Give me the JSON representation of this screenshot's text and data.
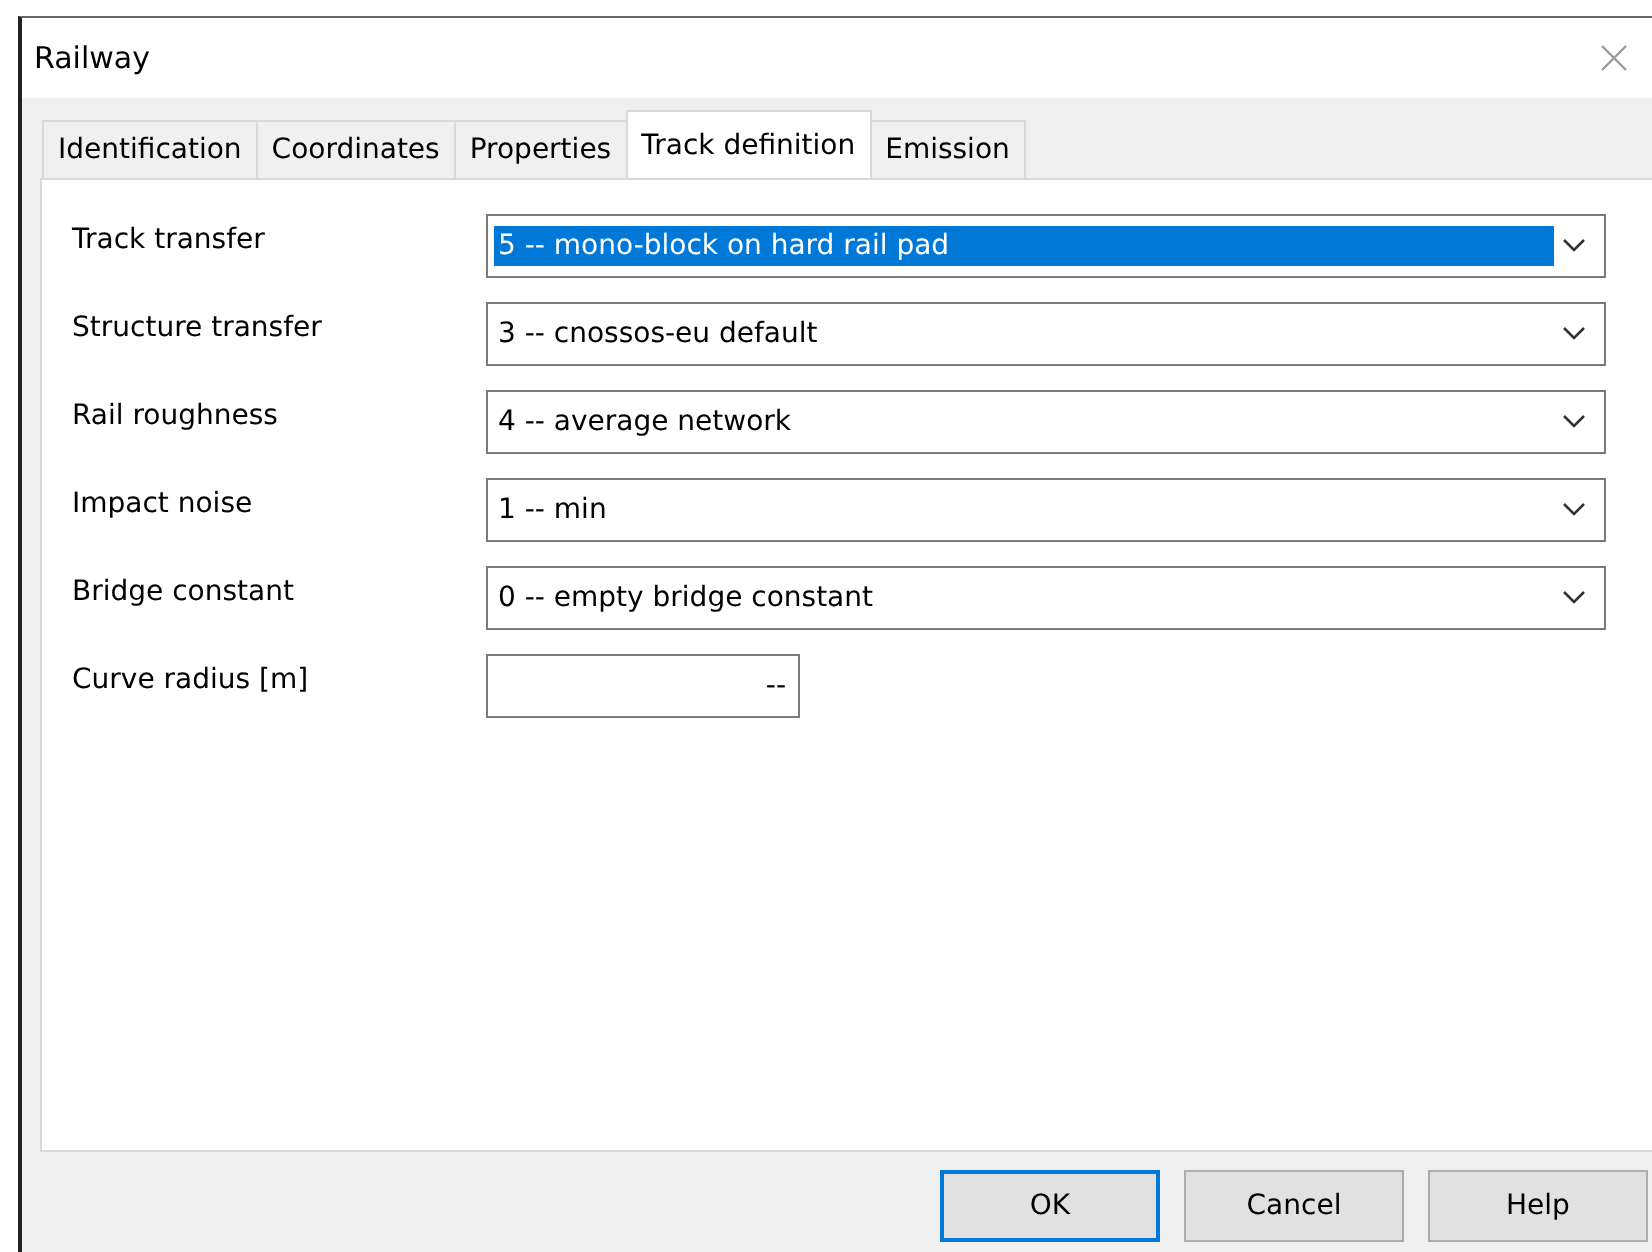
{
  "window": {
    "title": "Railway"
  },
  "tabs": [
    {
      "label": "Identification",
      "selected": false
    },
    {
      "label": "Coordinates",
      "selected": false
    },
    {
      "label": "Properties",
      "selected": false
    },
    {
      "label": "Track definition",
      "selected": true
    },
    {
      "label": "Emission",
      "selected": false
    }
  ],
  "fields": [
    {
      "label": "Track transfer",
      "kind": "combo",
      "value": "5 -- mono-block on hard rail pad",
      "focused": true
    },
    {
      "label": "Structure transfer",
      "kind": "combo",
      "value": "3 -- cnossos-eu default",
      "focused": false
    },
    {
      "label": "Rail roughness",
      "kind": "combo",
      "value": "4 -- average network",
      "focused": false
    },
    {
      "label": "Impact noise",
      "kind": "combo",
      "value": "1 -- min",
      "focused": false
    },
    {
      "label": "Bridge constant",
      "kind": "combo",
      "value": "0 -- empty bridge constant",
      "focused": false
    },
    {
      "label": "Curve radius [m]",
      "kind": "input",
      "value": "--",
      "focused": false
    }
  ],
  "buttons": [
    {
      "label": "OK",
      "default": true
    },
    {
      "label": "Cancel",
      "default": false
    },
    {
      "label": "Help",
      "default": false
    }
  ]
}
